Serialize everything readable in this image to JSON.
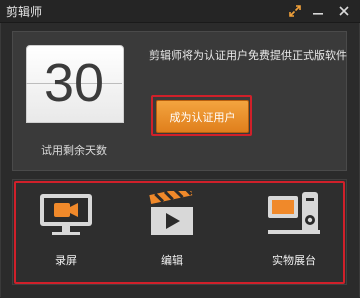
{
  "app": {
    "title": "剪辑师"
  },
  "window_controls": {
    "expand_icon": "expand-arrows-icon",
    "minimize_icon": "minimize-icon",
    "close_icon": "close-icon"
  },
  "trial": {
    "days_remaining": "30",
    "label": "试用剩余天数"
  },
  "promo": {
    "text": "剪辑师将为认证用户免费提供正式版软件",
    "button_label": "成为认证用户"
  },
  "tools": [
    {
      "label": "录屏",
      "icon": "screen-record-icon"
    },
    {
      "label": "编辑",
      "icon": "clapperboard-icon"
    },
    {
      "label": "实物展台",
      "icon": "document-camera-icon"
    }
  ],
  "colors": {
    "accent_orange": "#e8901f",
    "highlight_red": "#d0202a",
    "background": "#2b2b2b"
  }
}
